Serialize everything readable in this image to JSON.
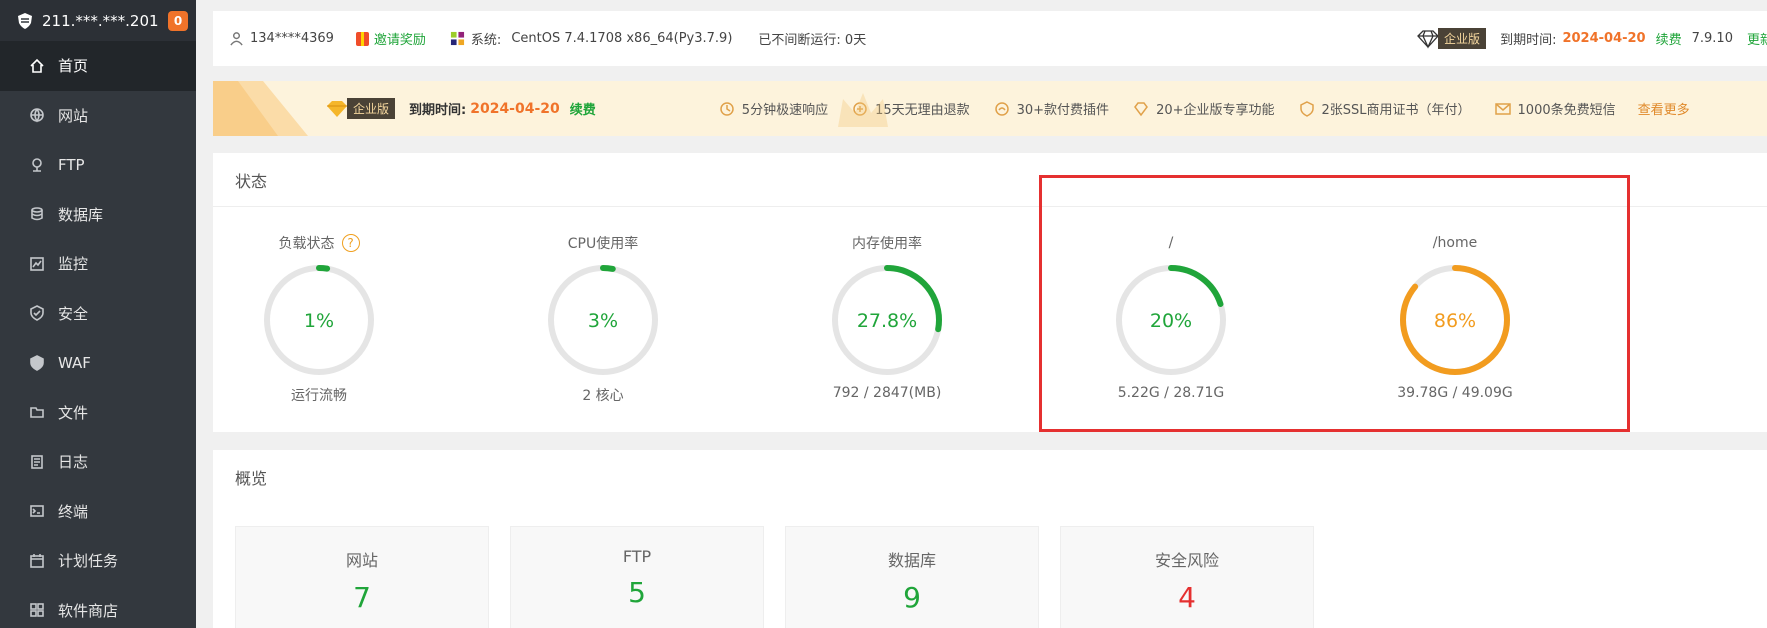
{
  "sidebar": {
    "ip": "211.***.***.201",
    "badge": "0",
    "items": [
      {
        "label": "首页",
        "icon": "home-icon",
        "active": true
      },
      {
        "label": "网站",
        "icon": "globe-icon"
      },
      {
        "label": "FTP",
        "icon": "ftp-icon"
      },
      {
        "label": "数据库",
        "icon": "database-icon"
      },
      {
        "label": "监控",
        "icon": "monitor-icon"
      },
      {
        "label": "安全",
        "icon": "shield-icon"
      },
      {
        "label": "WAF",
        "icon": "waf-shield-icon"
      },
      {
        "label": "文件",
        "icon": "folder-icon"
      },
      {
        "label": "日志",
        "icon": "log-icon"
      },
      {
        "label": "终端",
        "icon": "terminal-icon"
      },
      {
        "label": "计划任务",
        "icon": "calendar-icon"
      },
      {
        "label": "软件商店",
        "icon": "apps-icon"
      }
    ]
  },
  "topbar": {
    "user": "134****4369",
    "invite": "邀请奖励",
    "system_label": "系统:",
    "system_value": "CentOS 7.4.1708 x86_64(Py3.7.9)",
    "uptime": "已不间断运行: 0天",
    "edition": "企业版",
    "expire_label": "到期时间:",
    "expire_date": "2024-04-20",
    "renew": "续费",
    "version": "7.9.10",
    "update": "更新"
  },
  "promo": {
    "edition": "企业版",
    "expire_label": "到期时间:",
    "expire_date": "2024-04-20",
    "renew": "续费",
    "features": [
      {
        "label": "5分钟极速响应",
        "icon": "clock-icon"
      },
      {
        "label": "15天无理由退款",
        "icon": "refund-icon"
      },
      {
        "label": "30+款付费插件",
        "icon": "plugin-icon"
      },
      {
        "label": "20+企业版专享功能",
        "icon": "diamond-icon"
      },
      {
        "label": "2张SSL商用证书（年付）",
        "icon": "ssl-icon"
      },
      {
        "label": "1000条免费短信",
        "icon": "mail-icon"
      }
    ],
    "more": "查看更多"
  },
  "status": {
    "title": "状态",
    "gauges": [
      {
        "title": "负载状态",
        "value": "1%",
        "percent": 1,
        "subtitle": "运行流畅",
        "color": "#20a53a",
        "help": "?"
      },
      {
        "title": "CPU使用率",
        "value": "3%",
        "percent": 3,
        "subtitle": "2 核心",
        "color": "#20a53a"
      },
      {
        "title": "内存使用率",
        "value": "27.8%",
        "percent": 27.8,
        "subtitle": "792 / 2847(MB)",
        "color": "#20a53a"
      },
      {
        "title": "/",
        "value": "20%",
        "percent": 20,
        "subtitle": "5.22G / 28.71G",
        "color": "#20a53a"
      },
      {
        "title": "/home",
        "value": "86%",
        "percent": 86,
        "subtitle": "39.78G / 49.09G",
        "color": "#f29c1f"
      }
    ]
  },
  "overview": {
    "title": "概览",
    "cards": [
      {
        "label": "网站",
        "value": "7",
        "color": "#20a53a"
      },
      {
        "label": "FTP",
        "value": "5",
        "color": "#20a53a"
      },
      {
        "label": "数据库",
        "value": "9",
        "color": "#20a53a"
      },
      {
        "label": "安全风险",
        "value": "4",
        "color": "#e53030"
      }
    ]
  }
}
